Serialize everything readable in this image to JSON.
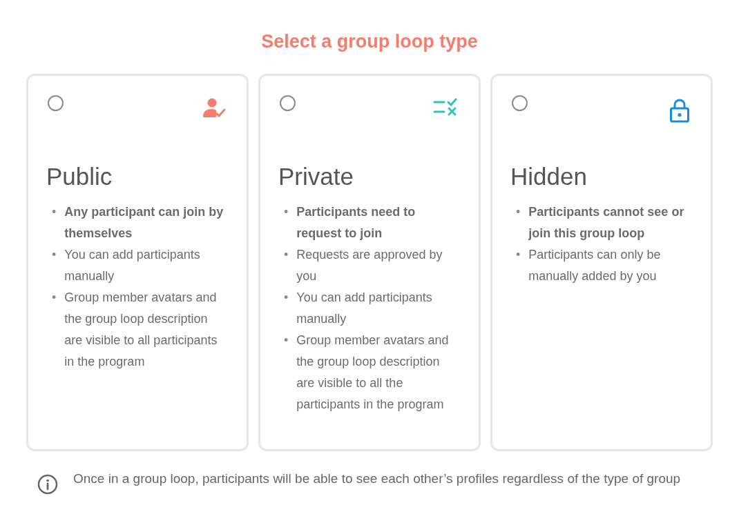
{
  "title": "Select a group loop type",
  "options": [
    {
      "title": "Public",
      "selected": false,
      "kind": "person",
      "bullets": [
        {
          "marker": "•",
          "text": "Any participant can join by themselves",
          "bold": true
        },
        {
          "marker": "•",
          "text": "You can add participants manually",
          "bold": false
        },
        {
          "marker": "•",
          "text": "Group member avatars and the group loop description are visible to all participants in the program",
          "bold": false
        }
      ]
    },
    {
      "title": "Private",
      "selected": false,
      "kind": "list",
      "bullets": [
        {
          "marker": "•",
          "text": "Participants need to request to join",
          "bold": true
        },
        {
          "marker": "•",
          "text": "Requests are approved by you",
          "bold": false
        },
        {
          "marker": "•",
          "text": "You can add participants manually",
          "bold": false
        },
        {
          "marker": "•",
          "text": "Group member avatars and the group loop description are visible to all the participants in the program",
          "bold": false
        }
      ]
    },
    {
      "title": "Hidden",
      "selected": false,
      "kind": "lock",
      "bullets": [
        {
          "marker": "•",
          "text": "Participants cannot see or join this group loop",
          "bold": true
        },
        {
          "marker": "•",
          "text": "Participants can only be manually added by you",
          "bold": false
        }
      ]
    }
  ],
  "note": "Once in a group loop, participants will be able to see each other’s profiles regardless of the type of group"
}
